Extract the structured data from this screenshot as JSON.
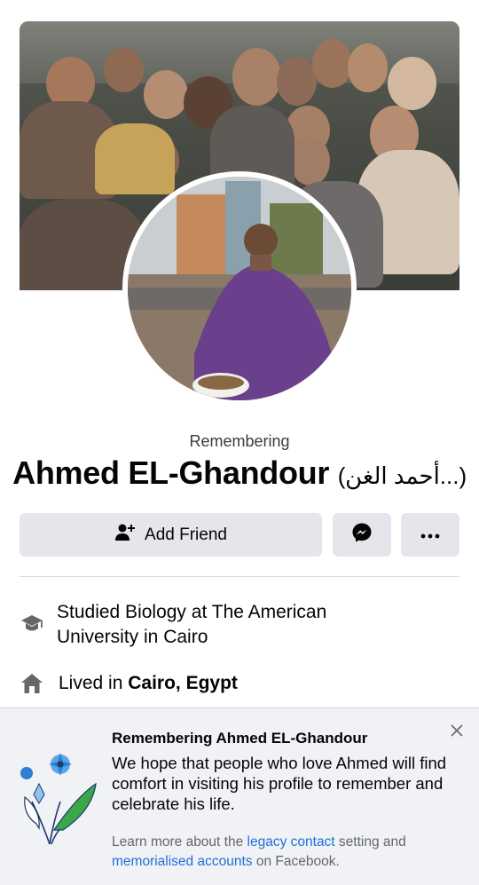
{
  "profile": {
    "remembering_label": "Remembering",
    "name": "Ahmed EL-Ghandour",
    "alt_name": "(أحمد الغن...)"
  },
  "actions": {
    "add_friend_label": "Add Friend"
  },
  "intro": {
    "education_prefix": "Studied Biology at The American University in Cairo",
    "lived_prefix": "Lived in ",
    "lived_place": "Cairo, Egypt"
  },
  "memorial": {
    "title": "Remembering Ahmed EL-Ghandour",
    "body": "We hope that people who love Ahmed will find comfort in visiting his profile to remember and celebrate his life.",
    "foot_1": "Learn more about the ",
    "link_1": "legacy contact",
    "foot_2": " setting and ",
    "link_2": "memorialised accounts",
    "foot_3": " on Facebook."
  },
  "colors": {
    "button_bg": "#e4e6eb",
    "link": "#216fdb",
    "banner_bg": "#f0f2f5"
  },
  "icons": [
    "user-plus-icon",
    "messenger-icon",
    "more-icon",
    "graduation-cap-icon",
    "home-icon",
    "close-icon",
    "flower-icon"
  ]
}
